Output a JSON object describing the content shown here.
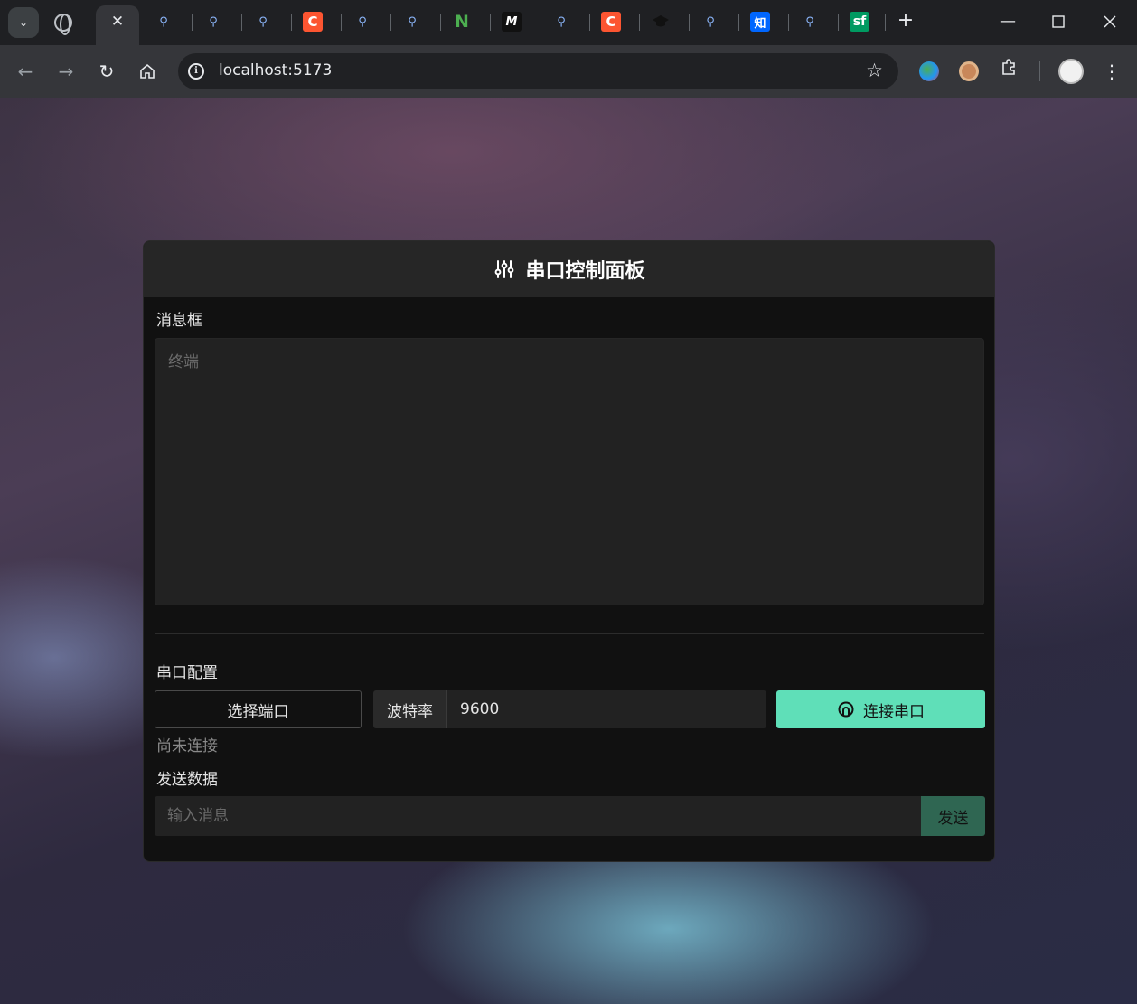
{
  "browser": {
    "tabs": [
      {
        "icon": "globe-icon"
      },
      {
        "icon": "close-icon",
        "active": true,
        "close_glyph": "✕"
      },
      {
        "icon": "search-icon"
      },
      {
        "icon": "search-icon"
      },
      {
        "icon": "search-icon"
      },
      {
        "icon": "csdn-icon",
        "glyph": "C"
      },
      {
        "icon": "search-icon"
      },
      {
        "icon": "search-icon"
      },
      {
        "icon": "n-logo-icon",
        "glyph": "N"
      },
      {
        "icon": "m-logo-icon",
        "glyph": "M"
      },
      {
        "icon": "search-icon"
      },
      {
        "icon": "csdn-icon",
        "glyph": "C"
      },
      {
        "icon": "graduation-cap-icon"
      },
      {
        "icon": "search-icon"
      },
      {
        "icon": "zhihu-icon",
        "glyph": "知"
      },
      {
        "icon": "search-icon"
      },
      {
        "icon": "segmentfault-icon",
        "glyph": "sf"
      }
    ],
    "address": "localhost:5173",
    "accent": "#8ab4f8"
  },
  "panel": {
    "title": "串口控制面板",
    "message_section_label": "消息框",
    "terminal_placeholder": "终端",
    "config_section_label": "串口配置",
    "select_port_label": "选择端口",
    "baud_label": "波特率",
    "baud_value": "9600",
    "connect_label": "连接串口",
    "status_text": "尚未连接",
    "send_section_label": "发送数据",
    "message_placeholder": "输入消息",
    "send_label": "发送",
    "colors": {
      "connect_button": "#5fdfb8",
      "send_button": "#2f6652",
      "panel_bg": "#111111",
      "header_bg": "#262626"
    }
  }
}
